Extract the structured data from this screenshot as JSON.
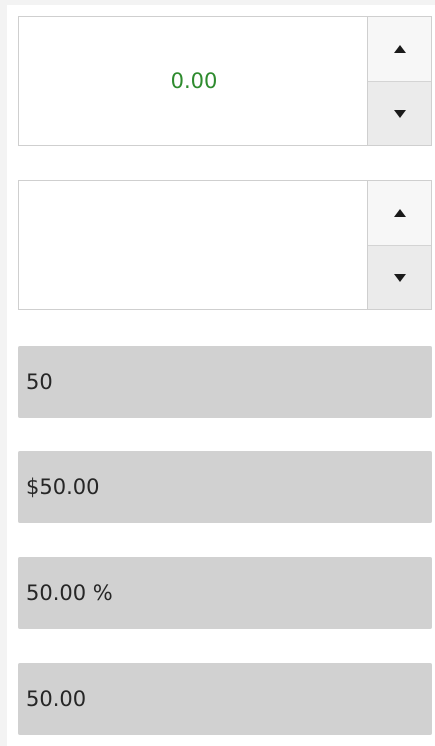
{
  "colors": {
    "value_text": "#2e8b2e",
    "readonly_background": "#d1d1d1",
    "readonly_text": "#262626"
  },
  "steppers": [
    {
      "value": "0.00",
      "up_icon": "triangle-up-icon",
      "down_icon": "triangle-down-icon"
    },
    {
      "value": "",
      "up_icon": "triangle-up-icon",
      "down_icon": "triangle-down-icon"
    }
  ],
  "fields": [
    {
      "text": "50"
    },
    {
      "text": "$50.00"
    },
    {
      "text": "50.00 %"
    },
    {
      "text": "50.00"
    }
  ]
}
